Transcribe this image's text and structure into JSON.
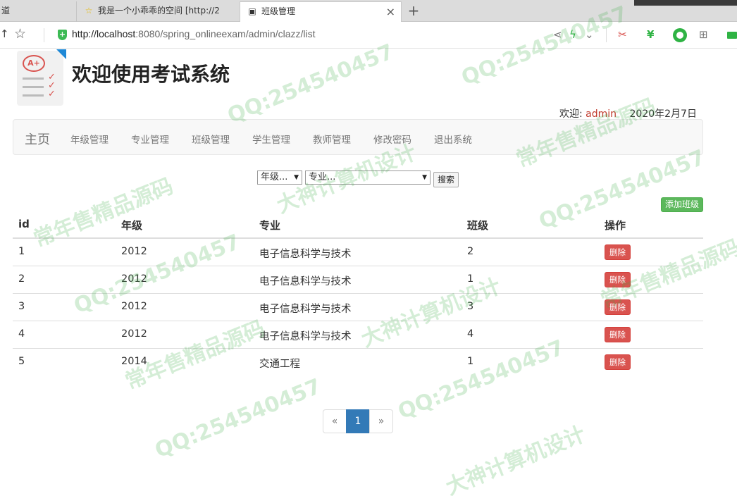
{
  "browser": {
    "tabs": [
      {
        "icon": "",
        "label": "道"
      },
      {
        "icon": "star-icon",
        "label": "我是一个小乖乖的空间 [http://2"
      },
      {
        "icon": "page-icon",
        "label": "班级管理",
        "close": "×"
      }
    ],
    "new_tab": "+",
    "url_host": "http://localhost",
    "url_rest": ":8080/spring_onlineexam/admin/clazz/list"
  },
  "header": {
    "title": "欢迎使用考试系统",
    "welcome_label": "欢迎:",
    "username": "admin",
    "date": "2020年2月7日"
  },
  "nav": {
    "brand": "主页",
    "items": [
      "年级管理",
      "专业管理",
      "班级管理",
      "学生管理",
      "教师管理",
      "修改密码",
      "退出系统"
    ]
  },
  "search": {
    "grade_select": "年级...",
    "major_select": "专业...",
    "button": "搜索"
  },
  "add_button": "添加班级",
  "table": {
    "headers": [
      "id",
      "年级",
      "专业",
      "班级",
      "操作"
    ],
    "rows": [
      {
        "id": "1",
        "grade": "2012",
        "major": "电子信息科学与技术",
        "clazz": "2",
        "action": "删除"
      },
      {
        "id": "2",
        "grade": "2012",
        "major": "电子信息科学与技术",
        "clazz": "1",
        "action": "删除"
      },
      {
        "id": "3",
        "grade": "2012",
        "major": "电子信息科学与技术",
        "clazz": "3",
        "action": "删除"
      },
      {
        "id": "4",
        "grade": "2012",
        "major": "电子信息科学与技术",
        "clazz": "4",
        "action": "删除"
      },
      {
        "id": "5",
        "grade": "2014",
        "major": "交通工程",
        "clazz": "1",
        "action": "删除"
      }
    ]
  },
  "pagination": {
    "prev": "«",
    "current": "1",
    "next": "»"
  },
  "watermark": {
    "qq": "QQ:254540457",
    "shop": "常年售精品源码",
    "studio": "大神计算机设计"
  }
}
